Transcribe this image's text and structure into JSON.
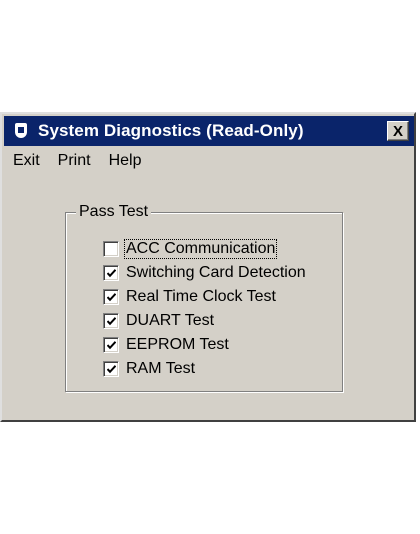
{
  "window": {
    "title": "System Diagnostics (Read-Only)",
    "close_label": "X",
    "titlebar_color": "#0a246a",
    "face_color": "#d4d0c8"
  },
  "menu": [
    "Exit",
    "Print",
    "Help"
  ],
  "pass_test": {
    "legend": "Pass Test",
    "items": [
      {
        "label": "ACC Communication",
        "checked": false,
        "focused": true
      },
      {
        "label": "Switching Card Detection",
        "checked": true,
        "focused": false
      },
      {
        "label": "Real Time Clock Test",
        "checked": true,
        "focused": false
      },
      {
        "label": "DUART Test",
        "checked": true,
        "focused": false
      },
      {
        "label": "EEPROM Test",
        "checked": true,
        "focused": false
      },
      {
        "label": "RAM Test",
        "checked": true,
        "focused": false
      }
    ]
  }
}
